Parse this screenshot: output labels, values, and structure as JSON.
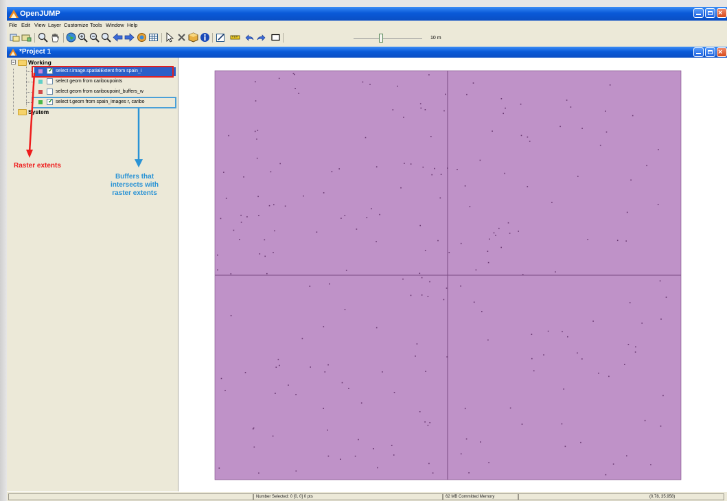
{
  "app": {
    "title": "OpenJUMP"
  },
  "menu": [
    "File",
    "Edit",
    "View",
    "Layer",
    "Customize",
    "Tools",
    "Window",
    "Help"
  ],
  "toolbar": {
    "buttons": [
      "layer-view-icon",
      "zoom-to-layer-icon",
      "zoom-icon",
      "pan-icon",
      "globe-icon",
      "zoom-in-icon",
      "zoom-out-icon",
      "zoom-previous-icon",
      "arrow-left-icon",
      "arrow-right-icon",
      "zoom-to-fence-icon",
      "grid-icon",
      "select-icon",
      "delete-icon",
      "cube-icon",
      "info-icon",
      "edit-icon",
      "ruler-icon",
      "undo-icon",
      "redo-icon",
      "rectangle-icon"
    ],
    "scale_label": "10 m",
    "scale_fraction": 0.4
  },
  "project": {
    "title": "*Project  1"
  },
  "tree": {
    "categories": [
      {
        "label": "Working",
        "layers": [
          {
            "label": "select r.image.spatialExtent from spain_i",
            "color": "#c78ad8",
            "checked": true,
            "selected": true
          },
          {
            "label": "select geom from cariboupoints",
            "color": "#5fd0c8",
            "checked": false,
            "selected": false
          },
          {
            "label": "select geom from cariboupoint_buffers_w",
            "color": "#d04a4a",
            "checked": false,
            "selected": false
          },
          {
            "label": "select t.geom from spain_images r, caribo",
            "color": "#48b848",
            "checked": true,
            "selected": false
          }
        ]
      },
      {
        "label": "System",
        "layers": []
      }
    ]
  },
  "annotations": {
    "raster": "Raster extents",
    "buffers": [
      "Buffers that",
      "intersects with",
      "raster extents"
    ]
  },
  "status": {
    "left": "",
    "selected": "Number Selected: 0 [0, 0] 0 pts",
    "memory": "62 MB Committed Memory",
    "coords": "(0.78, 35.958)"
  },
  "colors": {
    "raster_fill": "#bf92c8",
    "raster_outline": "#7a4a82",
    "point_color": "#6a3a72",
    "titlebar": "#0a5ad8"
  }
}
